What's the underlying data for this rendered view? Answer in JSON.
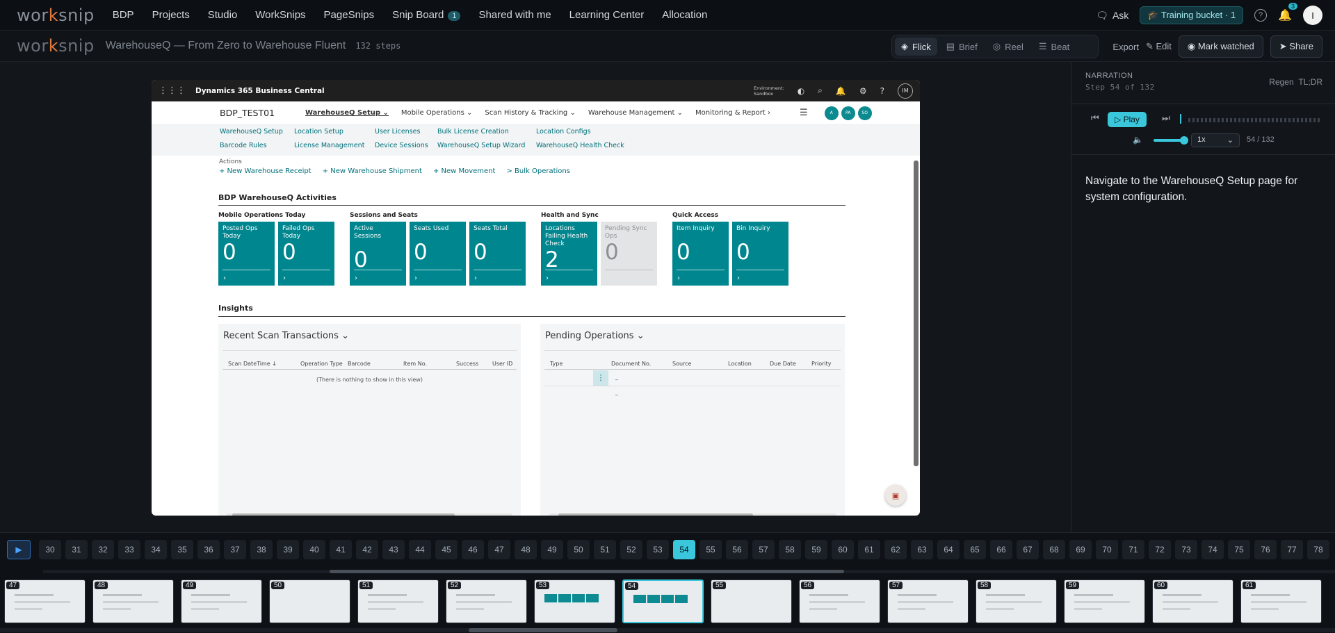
{
  "topbar": {
    "logo_pre": "wor",
    "logo_k": "k",
    "logo_post": "snip",
    "nav": [
      "BDP",
      "Projects",
      "Studio",
      "WorkSnips",
      "PageSnips",
      "Snip Board",
      "Shared with me",
      "Learning Center",
      "Allocation"
    ],
    "snip_board_badge": "1",
    "ask": "Ask",
    "bucket": "Training bucket · 1",
    "notif_count": "3",
    "avatar": "I"
  },
  "subbar": {
    "title": "WarehouseQ — From Zero to Warehouse Fluent",
    "steps": "132 steps",
    "modes": [
      {
        "label": "Flick",
        "icon": "layers-icon"
      },
      {
        "label": "Brief",
        "icon": "doc-icon"
      },
      {
        "label": "Reel",
        "icon": "play-circle-icon"
      },
      {
        "label": "Beat",
        "icon": "list-icon"
      }
    ],
    "export": "Export",
    "edit": "Edit",
    "mark_watched": "Mark watched",
    "share": "Share"
  },
  "bc": {
    "product": "Dynamics 365 Business Central",
    "env_line1": "Environment:",
    "env_line2": "Sandbox",
    "user_initials": "IM",
    "company": "BDP_TEST01",
    "menu": [
      "WarehouseQ Setup",
      "Mobile Operations",
      "Scan History & Tracking",
      "Warehouse Management",
      "Monitoring & Report"
    ],
    "avatars": [
      "A",
      "PA",
      "SO"
    ],
    "sublinks": [
      "WarehouseQ Setup",
      "Location Setup",
      "User Licenses",
      "Bulk License Creation",
      "Location Configs",
      "Barcode Rules",
      "License Management",
      "Device Sessions",
      "WarehouseQ Setup Wizard",
      "WarehouseQ Health Check"
    ],
    "actions_label": "Actions",
    "actions": [
      "+ New Warehouse Receipt",
      "+ New Warehouse Shipment",
      "+ New Movement",
      "> Bulk Operations"
    ],
    "activities_title": "BDP WarehouseQ Activities",
    "groups": [
      {
        "label": "Mobile Operations Today",
        "tiles": [
          {
            "title": "Posted Ops Today",
            "value": "0"
          },
          {
            "title": "Failed Ops Today",
            "value": "0"
          }
        ]
      },
      {
        "label": "Sessions and Seats",
        "tiles": [
          {
            "title": "Active Sessions",
            "value": "0"
          },
          {
            "title": "Seats Used",
            "value": "0"
          },
          {
            "title": "Seats Total",
            "value": "0"
          }
        ]
      },
      {
        "label": "Health and Sync",
        "tiles": [
          {
            "title": "Locations Failing Health Check",
            "value": "2"
          },
          {
            "title": "Pending Sync Ops",
            "value": "0"
          }
        ]
      },
      {
        "label": "Quick Access",
        "tiles": [
          {
            "title": "Item Inquiry",
            "value": "0"
          },
          {
            "title": "Bin Inquiry",
            "value": "0"
          }
        ]
      }
    ],
    "insights_title": "Insights",
    "recent_title": "Recent Scan Transactions",
    "recent_cols": [
      "Scan DateTime ↓",
      "Operation Type",
      "Barcode",
      "Item No.",
      "Success",
      "User ID"
    ],
    "recent_empty": "(There is nothing to show in this view)",
    "pending_title": "Pending Operations",
    "pending_cols": [
      "Type",
      "Document No.",
      "Source",
      "Location",
      "Due Date",
      "Priority"
    ],
    "pending_dash": "_"
  },
  "narration": {
    "header": "NARRATION",
    "step": "Step 54 of 132",
    "regen": "Regen",
    "tldr": "TL;DR",
    "play": "Play",
    "speed": "1x",
    "ratio": "54 / 132",
    "volume_level": 0.8,
    "text": "Navigate to the WarehouseQ Setup page for system configuration."
  },
  "strip": {
    "numbers": [
      "30",
      "31",
      "32",
      "33",
      "34",
      "35",
      "36",
      "37",
      "38",
      "39",
      "40",
      "41",
      "42",
      "43",
      "44",
      "45",
      "46",
      "47",
      "48",
      "49",
      "50",
      "51",
      "52",
      "53",
      "54",
      "55",
      "56",
      "57",
      "58",
      "59",
      "60",
      "61",
      "62",
      "63",
      "64",
      "65",
      "66",
      "67",
      "68",
      "69",
      "70",
      "71",
      "72",
      "73",
      "74",
      "75",
      "76",
      "77",
      "78"
    ],
    "active": "54",
    "thumbs": [
      "47",
      "48",
      "49",
      "50",
      "51",
      "52",
      "53",
      "54",
      "55",
      "56",
      "57",
      "58",
      "59",
      "60",
      "61"
    ]
  }
}
